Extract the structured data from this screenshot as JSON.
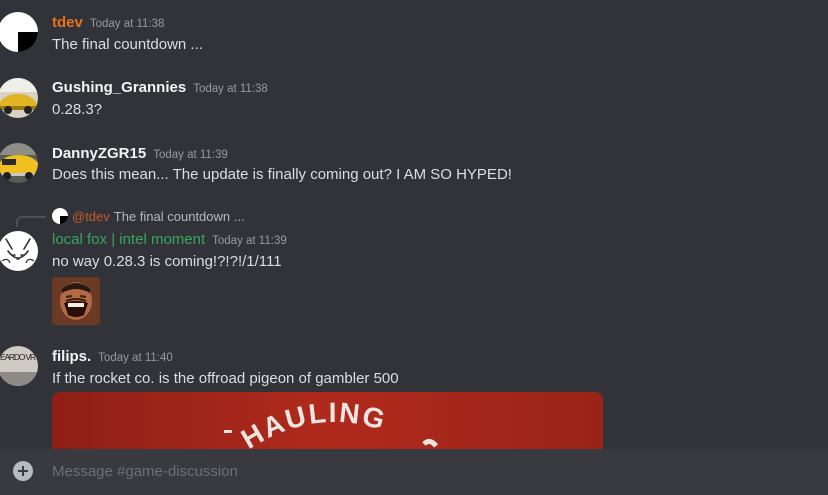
{
  "messages": [
    {
      "username": "tdev",
      "username_color": "#e8711a",
      "timestamp": "Today at 11:38",
      "content": "The final countdown ...",
      "avatar_icon": "tdev-avatar"
    },
    {
      "username": "Gushing_Grannies",
      "username_color": "#f2f3f5",
      "timestamp": "Today at 11:38",
      "content": "0.28.3?",
      "avatar_icon": "yellow-car-avatar"
    },
    {
      "username": "DannyZGR15",
      "username_color": "#f2f3f5",
      "timestamp": "Today at 11:39",
      "content": "Does this mean... The update is finally coming out? I AM SO HYPED!",
      "avatar_icon": "yellow-car-avatar"
    },
    {
      "username": "local fox | intel moment",
      "username_color": "#3ba55d",
      "timestamp": "Today at 11:39",
      "content": "no way 0.28.3 is coming!?!?!/1/111",
      "avatar_icon": "fox-sketch-avatar",
      "reply": {
        "mention": "@tdev",
        "preview": "The final countdown ..."
      },
      "attachment_icon": "laughing-man-emoji"
    },
    {
      "username": "filips.",
      "username_color": "#f2f3f5",
      "timestamp": "Today at 11:40",
      "content": "If the rocket co. is the offroad pigeon of gambler 500",
      "avatar_icon": "sign-avatar",
      "avatar_text": "EARDO VR",
      "embed_text": "HAULING"
    }
  ],
  "composer": {
    "placeholder": "Message #game-discussion",
    "add_icon": "plus-circle-icon"
  }
}
